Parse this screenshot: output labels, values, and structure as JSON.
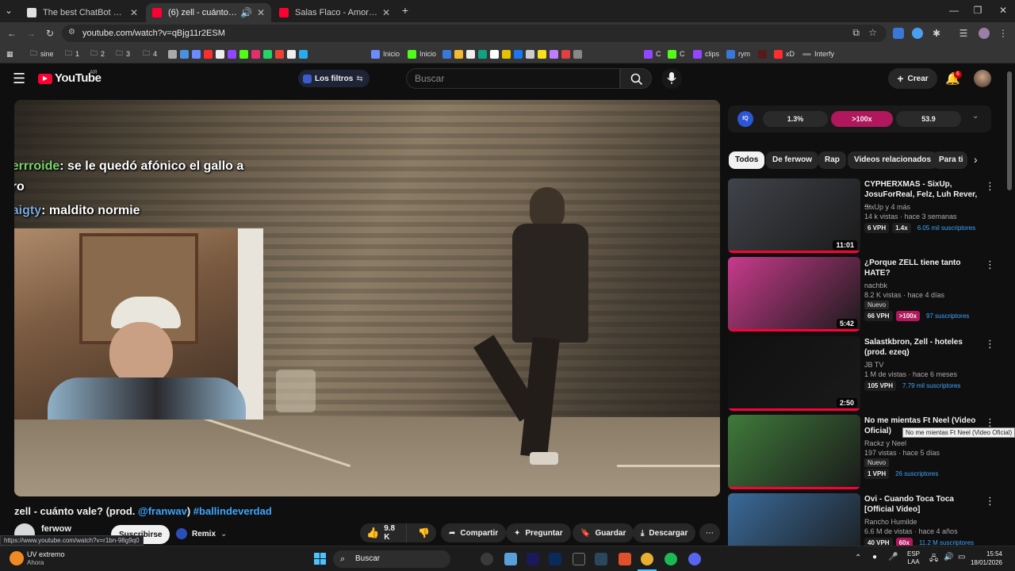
{
  "browser": {
    "tabs": [
      {
        "title": "The best ChatBot and Widgets f",
        "active": false
      },
      {
        "title": "(6) zell - cuánto vale? (prod.",
        "active": true
      },
      {
        "title": "Salas Flaco - Amor y Locura - Y",
        "active": false
      }
    ],
    "url": "youtube.com/watch?v=qBjg11r2ESM",
    "bookmarks": [
      "sine",
      "1",
      "2",
      "3",
      "4",
      "Inicio",
      "Inicio",
      "C",
      "C",
      "clips",
      "rym",
      "xD",
      "Interfy"
    ]
  },
  "youtube": {
    "logo_text": "YouTube",
    "region": "AR",
    "filters_label": "Los filtros",
    "search_placeholder": "Buscar",
    "create_label": "Crear",
    "notifications_count": "6"
  },
  "player": {
    "chat": [
      {
        "user": "perrroide",
        "user_color": "#7cd46f",
        "message": ": se le quedó afónico el gallo a"
      },
      {
        "user": "",
        "user_color": "#ffffff",
        "message": "tiro"
      },
      {
        "user": "naigty",
        "user_color": "#7aa7d8",
        "message": ": maldito normie"
      }
    ]
  },
  "video": {
    "title_prefix": "zell - cuánto vale? (prod. ",
    "title_mention": "@franwav",
    "title_tag": "#ballindeverdad",
    "channel": "ferwow",
    "subscribe_label": "Suscribirse",
    "remix_label": "Remix",
    "likes": "9.8 K",
    "share_label": "Compartir",
    "ask_label": "Preguntar",
    "save_label": "Guardar",
    "download_label": "Descargar",
    "status_url": "https://www.youtube.com/watch?v=r1bn-98g9q0"
  },
  "extension": {
    "values": [
      "1.3%",
      ">100x",
      "53.9"
    ]
  },
  "chips": [
    "Todos",
    "De ferwow",
    "Rap",
    "Videos relacionados",
    "Para ti"
  ],
  "recommendations": [
    {
      "title": "CYPHERXMAS - SixUp, JosuForReal, Felz, Luh Rever, ...",
      "channel": "SixUp y 4 más",
      "meta": "14 k vistas · hace 3 semanas",
      "badge": "",
      "vph": "6 VPH",
      "mult": "1.4x",
      "subs": "6.05 mil suscriptores",
      "duration": "11:01",
      "thumb": "#40434a"
    },
    {
      "title": "¿Porque ZELL tiene tanto HATE?",
      "channel": "nachbk",
      "meta": "8.2 K vistas · hace 4 días",
      "badge": "Nuevo",
      "vph": "66 VPH",
      "mult": ">100x",
      "subs": "97 suscriptores",
      "duration": "5:42",
      "thumb": "#c83a8c"
    },
    {
      "title": "Salastkbron, Zell - hoteles (prod. ezeq)",
      "channel": "JB TV",
      "meta": "1 M de vistas · hace 6 meses",
      "badge": "",
      "vph": "105 VPH",
      "mult": "",
      "subs": "7.79 mil suscriptores",
      "duration": "2:50",
      "thumb": "#101010"
    },
    {
      "title": "No me mientas Ft Neel (Video Oficial)",
      "channel": "Rackz y Neel",
      "meta": "197 vistas · hace 5 días",
      "badge": "Nuevo",
      "vph": "1 VPH",
      "mult": "",
      "subs": "26 suscriptores",
      "duration": "",
      "thumb": "#3f7a3a"
    },
    {
      "title": "Ovi - Cuando Toca Toca [Official Video]",
      "channel": "Rancho Humilde",
      "meta": "6.6 M de vistas · hace 4 años",
      "badge": "",
      "vph": "40 VPH",
      "mult": "60x",
      "subs": "11.2 M suscriptores",
      "duration": "",
      "thumb": "#3a6a9a"
    }
  ],
  "tooltip": "No me mientas Ft Neel (Video Oficial)",
  "taskbar": {
    "weather_title": "UV extremo",
    "weather_sub": "Ahora",
    "search_label": "Buscar",
    "lang_top": "ESP",
    "lang_bottom": "LAA",
    "time": "15:54",
    "date": "18/01/2026"
  }
}
